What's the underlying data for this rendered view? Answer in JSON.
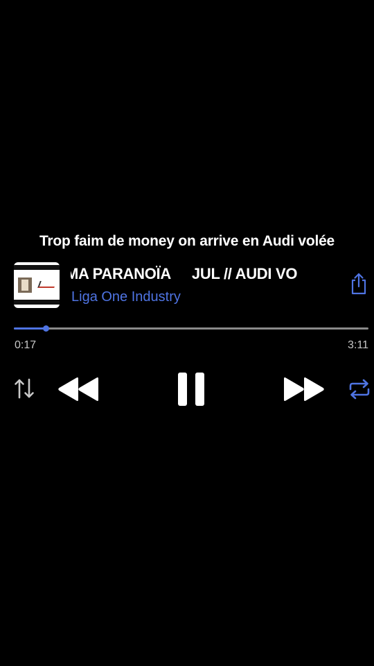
{
  "lyric": "Trop faim de money on arrive en Audi volée",
  "track": {
    "title_scroll": "MA PARANOÏA",
    "title_next": "JUL // AUDI VO",
    "artist": "Liga One Industry"
  },
  "playback": {
    "elapsed": "0:17",
    "total": "3:11",
    "progress_fraction": 0.09
  },
  "icons": {
    "share": "share-icon",
    "sort": "sort-arrows-icon",
    "rewind": "rewind-icon",
    "pause": "pause-icon",
    "forward": "fast-forward-icon",
    "repeat": "repeat-icon"
  },
  "colors": {
    "background": "#000000",
    "accent": "#4f74e3",
    "text": "#ffffff",
    "muted": "#c8c8c8",
    "track": "#8a8a8a"
  }
}
